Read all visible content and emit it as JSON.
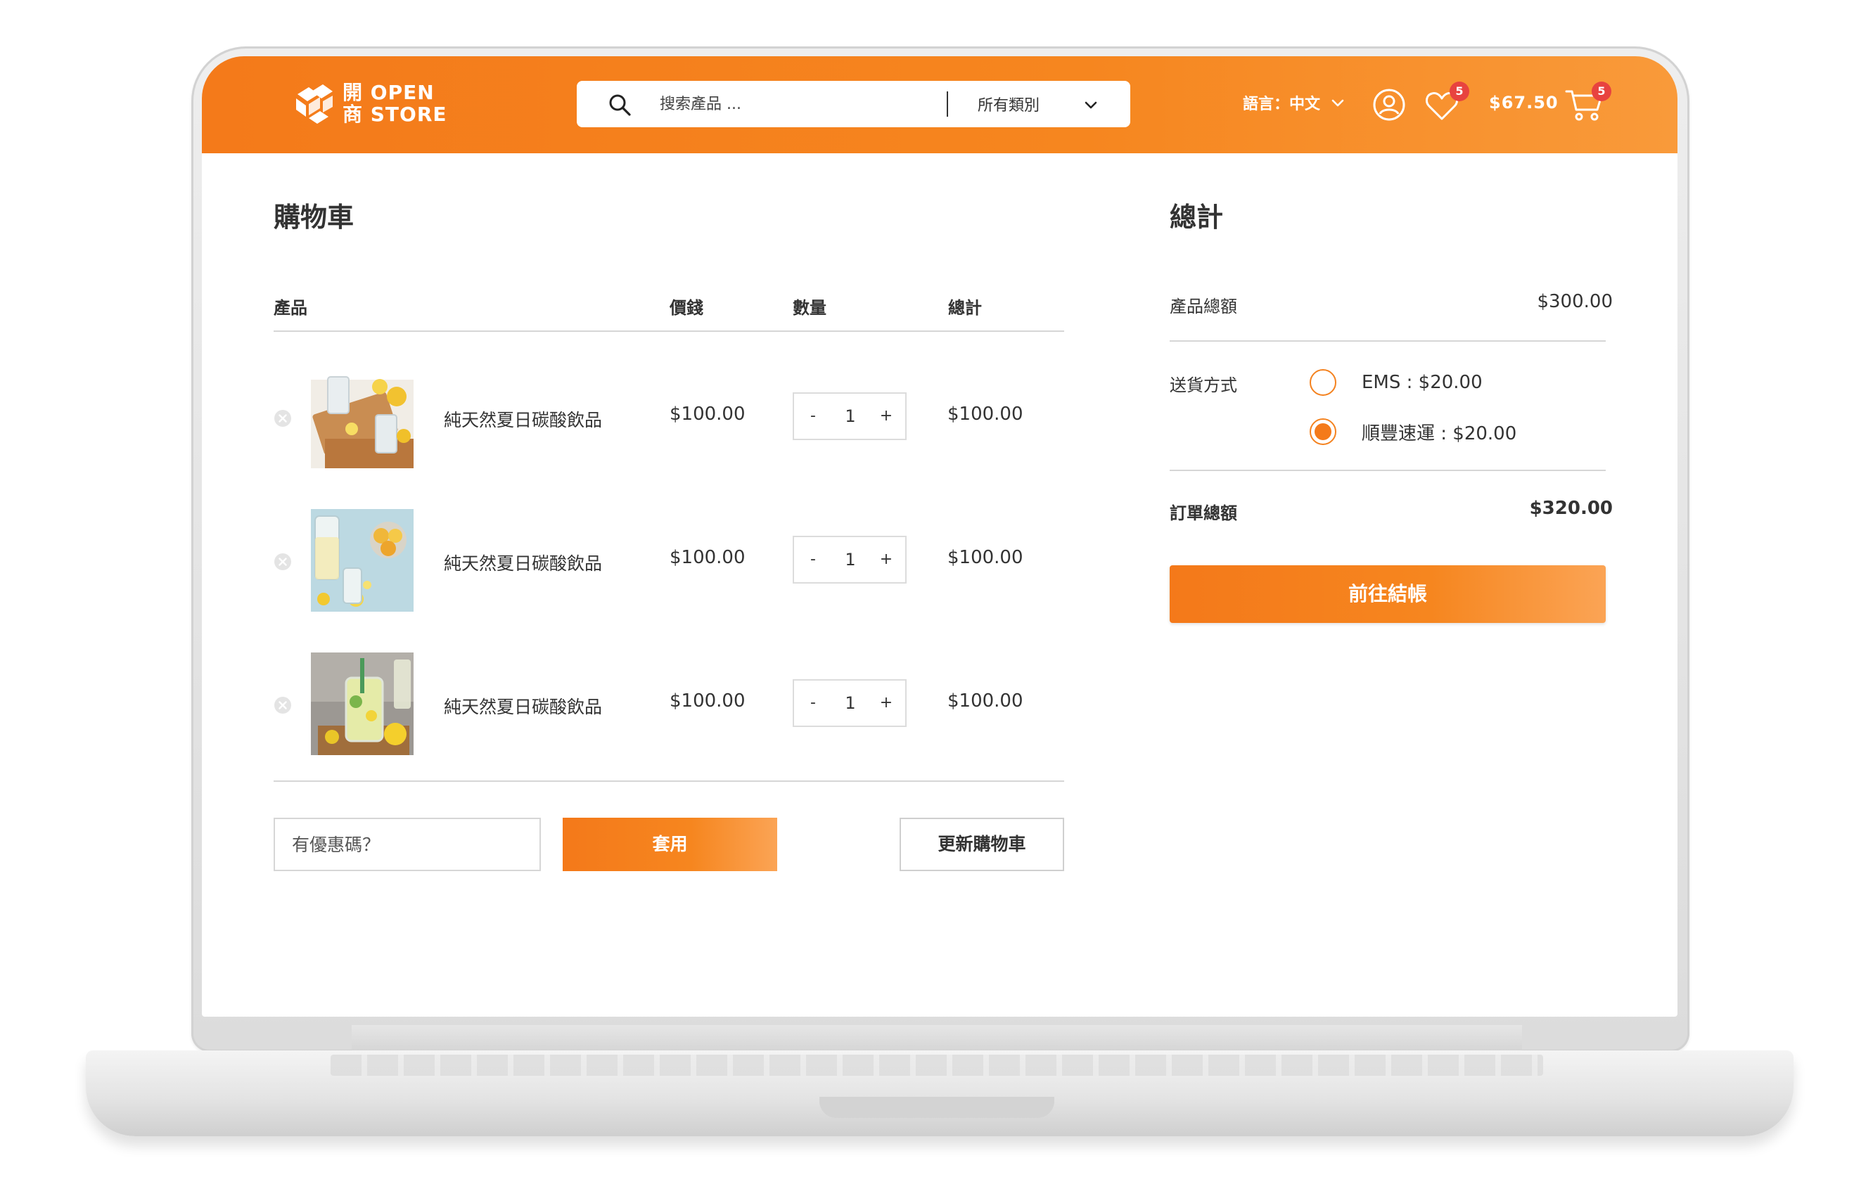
{
  "header": {
    "logo": {
      "cjk_1": "開",
      "latin_1": "OPEN",
      "cjk_2": "商",
      "latin_2": "STORE"
    },
    "search": {
      "placeholder": "搜索產品 ...",
      "icon": "search-icon"
    },
    "category": {
      "selected": "所有類別",
      "icon": "chevron-down-icon"
    },
    "language": {
      "label": "語言：中文",
      "icon": "chevron-down-icon"
    },
    "account": {
      "icon": "user-icon"
    },
    "wishlist": {
      "icon": "heart-icon",
      "count": "5"
    },
    "cart": {
      "amount": "$67.50",
      "icon": "cart-icon",
      "count": "5"
    }
  },
  "cart": {
    "title": "購物車",
    "columns": {
      "product": "產品",
      "price": "價錢",
      "quantity": "數量",
      "total": "總計"
    },
    "items": [
      {
        "name": "純天然夏日碳酸飲品",
        "price": "$100.00",
        "quantity": "1",
        "total": "$100.00",
        "minus": "-",
        "plus": "+"
      },
      {
        "name": "純天然夏日碳酸飲品",
        "price": "$100.00",
        "quantity": "1",
        "total": "$100.00",
        "minus": "-",
        "plus": "+"
      },
      {
        "name": "純天然夏日碳酸飲品",
        "price": "$100.00",
        "quantity": "1",
        "total": "$100.00",
        "minus": "-",
        "plus": "+"
      }
    ],
    "coupon": {
      "placeholder": "有優惠碼？"
    },
    "apply_label": "套用",
    "update_label": "更新購物車"
  },
  "totals": {
    "title": "總計",
    "subtotal_label": "產品總額",
    "subtotal_value": "$300.00",
    "shipping_label": "送貨方式",
    "shipping_options": [
      {
        "label": "EMS : $20.00",
        "selected": false
      },
      {
        "label": "順豐速運 : $20.00",
        "selected": true
      }
    ],
    "order_total_label": "訂單總額",
    "order_total_value": "$320.00",
    "checkout_label": "前往結帳"
  },
  "colors": {
    "brand_orange": "#f6861f",
    "badge_red": "#e8433f",
    "text_dark": "#333333",
    "divider": "#d6d6d6"
  }
}
